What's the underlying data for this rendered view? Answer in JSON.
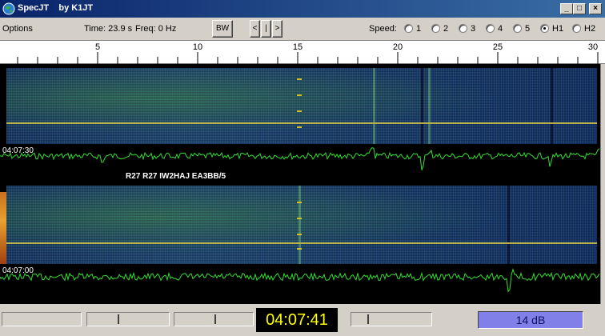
{
  "window": {
    "title": "SpecJT    by K1JT"
  },
  "window_buttons": {
    "minimize": "_",
    "maximize": "□",
    "close": "×"
  },
  "toolbar": {
    "options": "Options",
    "time": "Time: 23.9 s",
    "freq": "Freq: 0 Hz",
    "bw": "BW",
    "nav_left": "<",
    "nav_mid": "|",
    "nav_right": ">",
    "speed_label": "Speed:",
    "speed_options": [
      "1",
      "2",
      "3",
      "4",
      "5",
      "H1",
      "H2"
    ],
    "speed_selected": "H1"
  },
  "ruler": {
    "labels": [
      "5",
      "10",
      "15",
      "20",
      "25",
      "30"
    ]
  },
  "spectrogram": {
    "upper_time": "04:07:30",
    "lower_time": "04:07:00",
    "decode_text": "R27 R27 IW2HAJ EA3BB/5"
  },
  "status": {
    "clock": "04:07:41",
    "level": "14 dB"
  },
  "colors": {
    "title_bar": "#0a246a",
    "trace": "#33dd33",
    "clock_text": "#ffff00",
    "clock_bg": "#000000",
    "level_bg": "#8080e8"
  }
}
